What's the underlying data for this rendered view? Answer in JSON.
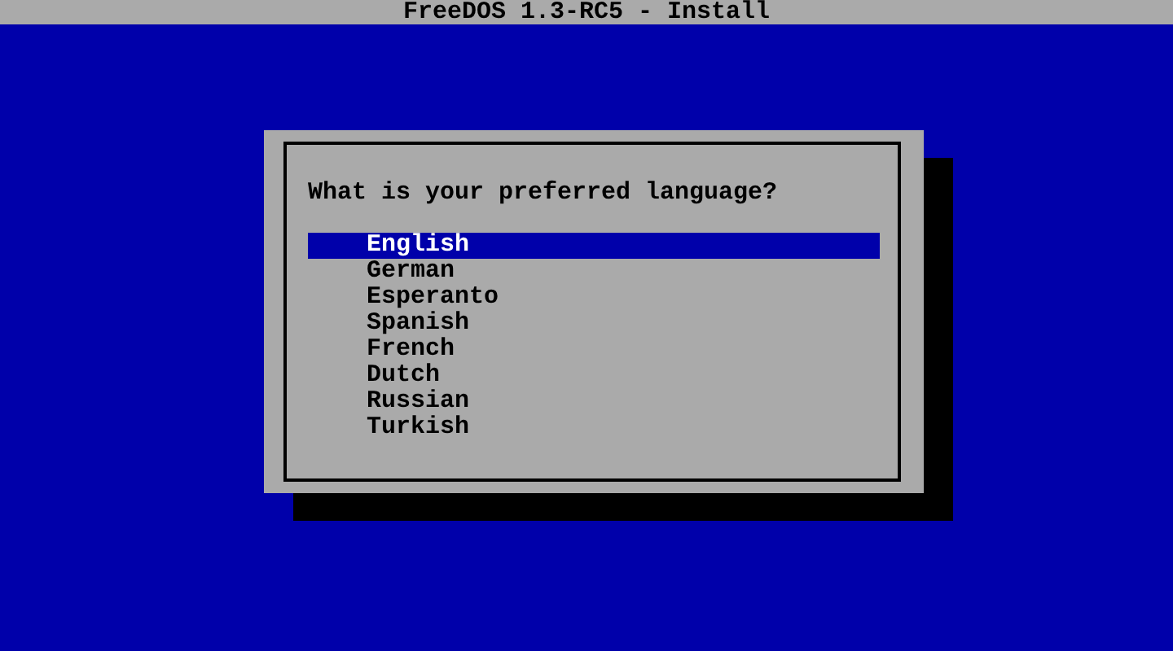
{
  "window": {
    "title": "FreeDOS 1.3-RC5 - Install"
  },
  "dialog": {
    "question": "What is your preferred language?",
    "options": [
      {
        "label": "English",
        "selected": true
      },
      {
        "label": "German",
        "selected": false
      },
      {
        "label": "Esperanto",
        "selected": false
      },
      {
        "label": "Spanish",
        "selected": false
      },
      {
        "label": "French",
        "selected": false
      },
      {
        "label": "Dutch",
        "selected": false
      },
      {
        "label": "Russian",
        "selected": false
      },
      {
        "label": "Turkish",
        "selected": false
      }
    ]
  }
}
